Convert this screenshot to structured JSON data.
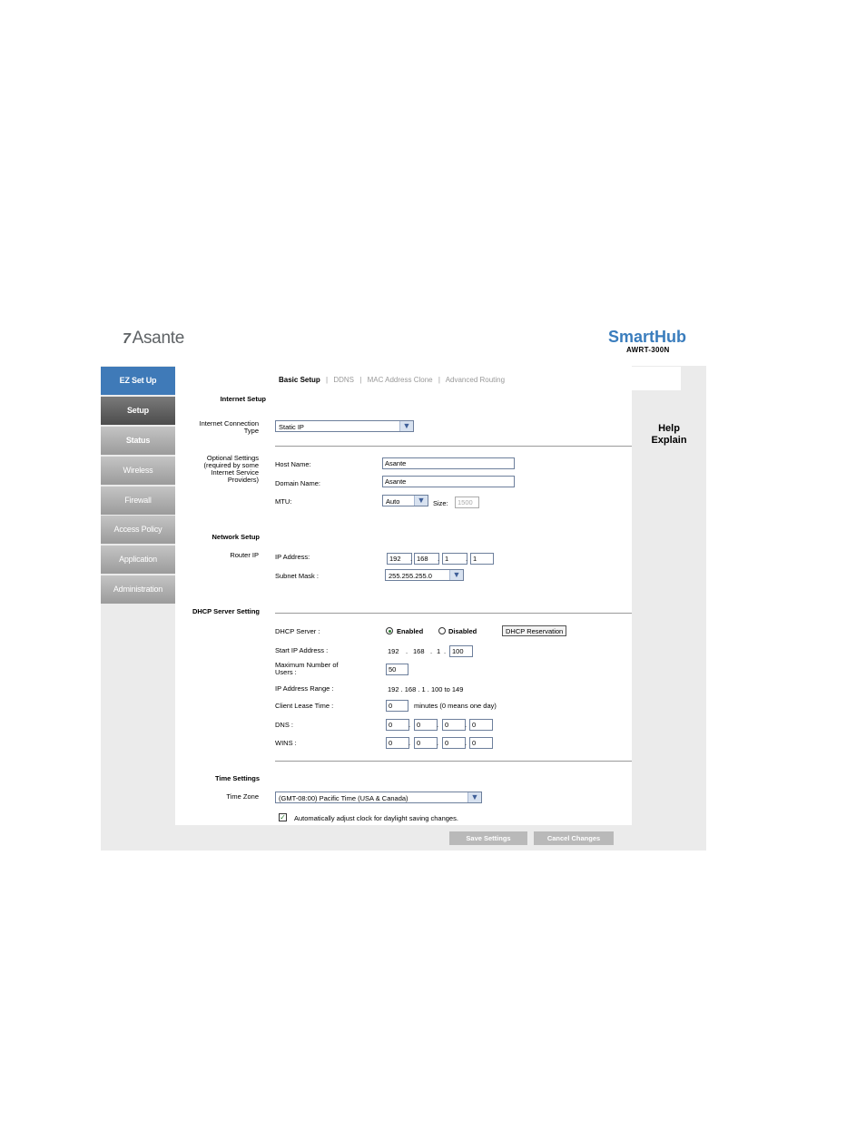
{
  "header": {
    "logo_text": "Asante",
    "logo_mark": "7",
    "brand": "SmartHub",
    "model": "AWRT-300N"
  },
  "nav": [
    "EZ Set Up",
    "Setup",
    "Status",
    "Wireless",
    "Firewall",
    "Access Policy",
    "Application",
    "Administration"
  ],
  "tabs": {
    "basic": "Basic Setup",
    "sep": "|",
    "ddns": "DDNS",
    "mac": "MAC Address Clone",
    "routing": "Advanced Routing"
  },
  "help": {
    "line1": "Help",
    "line2": "Explain"
  },
  "internet_setup": {
    "title": "Internet Setup",
    "conn_type_label": "Internet Connection Type",
    "conn_type_value": "Static IP",
    "optional_label": "Optional Settings (required by some Internet Service Providers)",
    "host_name_label": "Host Name:",
    "host_name_value": "Asante",
    "domain_name_label": "Domain Name:",
    "domain_name_value": "Asante",
    "mtu_label": "MTU:",
    "mtu_value": "Auto",
    "size_label": "Size:",
    "size_value": "1500"
  },
  "network_setup": {
    "title": "Network Setup",
    "router_ip_label": "Router IP",
    "ip_address_label": "IP Address:",
    "ip": [
      "192",
      "168",
      "1",
      "1"
    ],
    "subnet_label": "Subnet Mask :",
    "subnet_value": "255.255.255.0"
  },
  "dhcp": {
    "title": "DHCP Server Setting",
    "server_label": "DHCP Server :",
    "enabled": "Enabled",
    "disabled": "Disabled",
    "reservation_button": "DHCP Reservation",
    "start_ip_label": "Start IP Address :",
    "start_ip_prefix": [
      "192",
      "168",
      "1"
    ],
    "start_ip_last": "100",
    "max_users_label": "Maximum Number of Users :",
    "max_users_value": "50",
    "range_label": "IP Address Range :",
    "range_value": "192 . 168 . 1 . 100 to 149",
    "lease_label": "Client Lease Time :",
    "lease_value": "0",
    "lease_note": "minutes (0 means one day)",
    "dns_label": "DNS :",
    "dns": [
      "0",
      "0",
      "0",
      "0"
    ],
    "wins_label": "WINS :",
    "wins": [
      "0",
      "0",
      "0",
      "0"
    ]
  },
  "time": {
    "title": "Time Settings",
    "zone_label": "Time Zone",
    "zone_value": "(GMT-08:00) Pacific Time (USA & Canada)",
    "dst_label": "Automatically adjust clock for daylight saving changes."
  },
  "buttons": {
    "save": "Save Settings",
    "cancel": "Cancel Changes"
  }
}
